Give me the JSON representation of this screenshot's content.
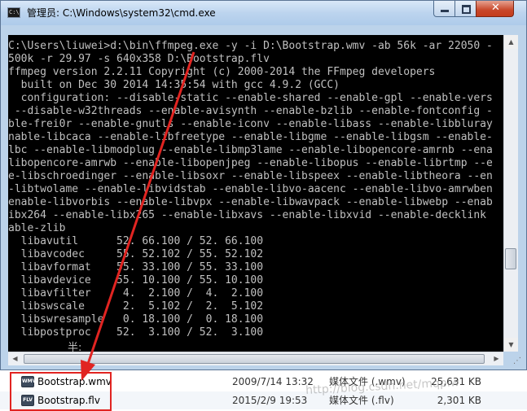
{
  "window": {
    "title": "管理员: C:\\Windows\\system32\\cmd.exe",
    "icon_label": "C:\\"
  },
  "console": {
    "lines": [
      "C:\\Users\\liuwei>d:\\bin\\ffmpeg.exe -y -i D:\\Bootstrap.wmv -ab 56k -ar 22050 -",
      "500k -r 29.97 -s 640x358 D:\\Bootstrap.flv",
      "ffmpeg version 2.2.11 Copyright (c) 2000-2014 the FFmpeg developers",
      "  built on Dec 30 2014 14:35:54 with gcc 4.9.2 (GCC)",
      "  configuration: --disable-static --enable-shared --enable-gpl --enable-vers",
      " --disable-w32threads --enable-avisynth --enable-bzlib --enable-fontconfig -",
      "ble-frei0r --enable-gnutls --enable-iconv --enable-libass --enable-libbluray",
      "nable-libcaca --enable-libfreetype --enable-libgme --enable-libgsm --enable-",
      "lbc --enable-libmodplug --enable-libmp3lame --enable-libopencore-amrnb --ena",
      "libopencore-amrwb --enable-libopenjpeg --enable-libopus --enable-librtmp --e",
      "e-libschroedinger --enable-libsoxr --enable-libspeex --enable-libtheora --en",
      "-libtwolame --enable-libvidstab --enable-libvo-aacenc --enable-libvo-amrwben",
      "enable-libvorbis --enable-libvpx --enable-libwavpack --enable-libwebp --enab",
      "ibx264 --enable-libx265 --enable-libxavs --enable-libxvid --enable-decklink",
      "able-zlib",
      "  libavutil      52. 66.100 / 52. 66.100",
      "  libavcodec     55. 52.102 / 55. 52.102",
      "  libavformat    55. 33.100 / 55. 33.100",
      "  libavdevice    55. 10.100 / 55. 10.100",
      "  libavfilter     4.  2.100 /  4.  2.100",
      "  libswscale      2.  5.102 /  2.  5.102",
      "  libswresample   0. 18.100 /  0. 18.100",
      "  libpostproc    52.  3.100 / 52.  3.100"
    ],
    "ime_char": "半:"
  },
  "files": [
    {
      "name": "Bootstrap.wmv",
      "date": "2009/7/14 13:32",
      "type": "媒体文件 (.wmv)",
      "size": "25,631 KB",
      "icon": "WMV"
    },
    {
      "name": "Bootstrap.flv",
      "date": "2015/2/9 19:53",
      "type": "媒体文件 (.flv)",
      "size": "2,301 KB",
      "icon": "FLV"
    }
  ],
  "watermark": "http://blog.csdn.net/mqplw",
  "colors": {
    "annotation": "#e12421",
    "console_bg": "#000000",
    "console_fg": "#c0c0c0"
  }
}
